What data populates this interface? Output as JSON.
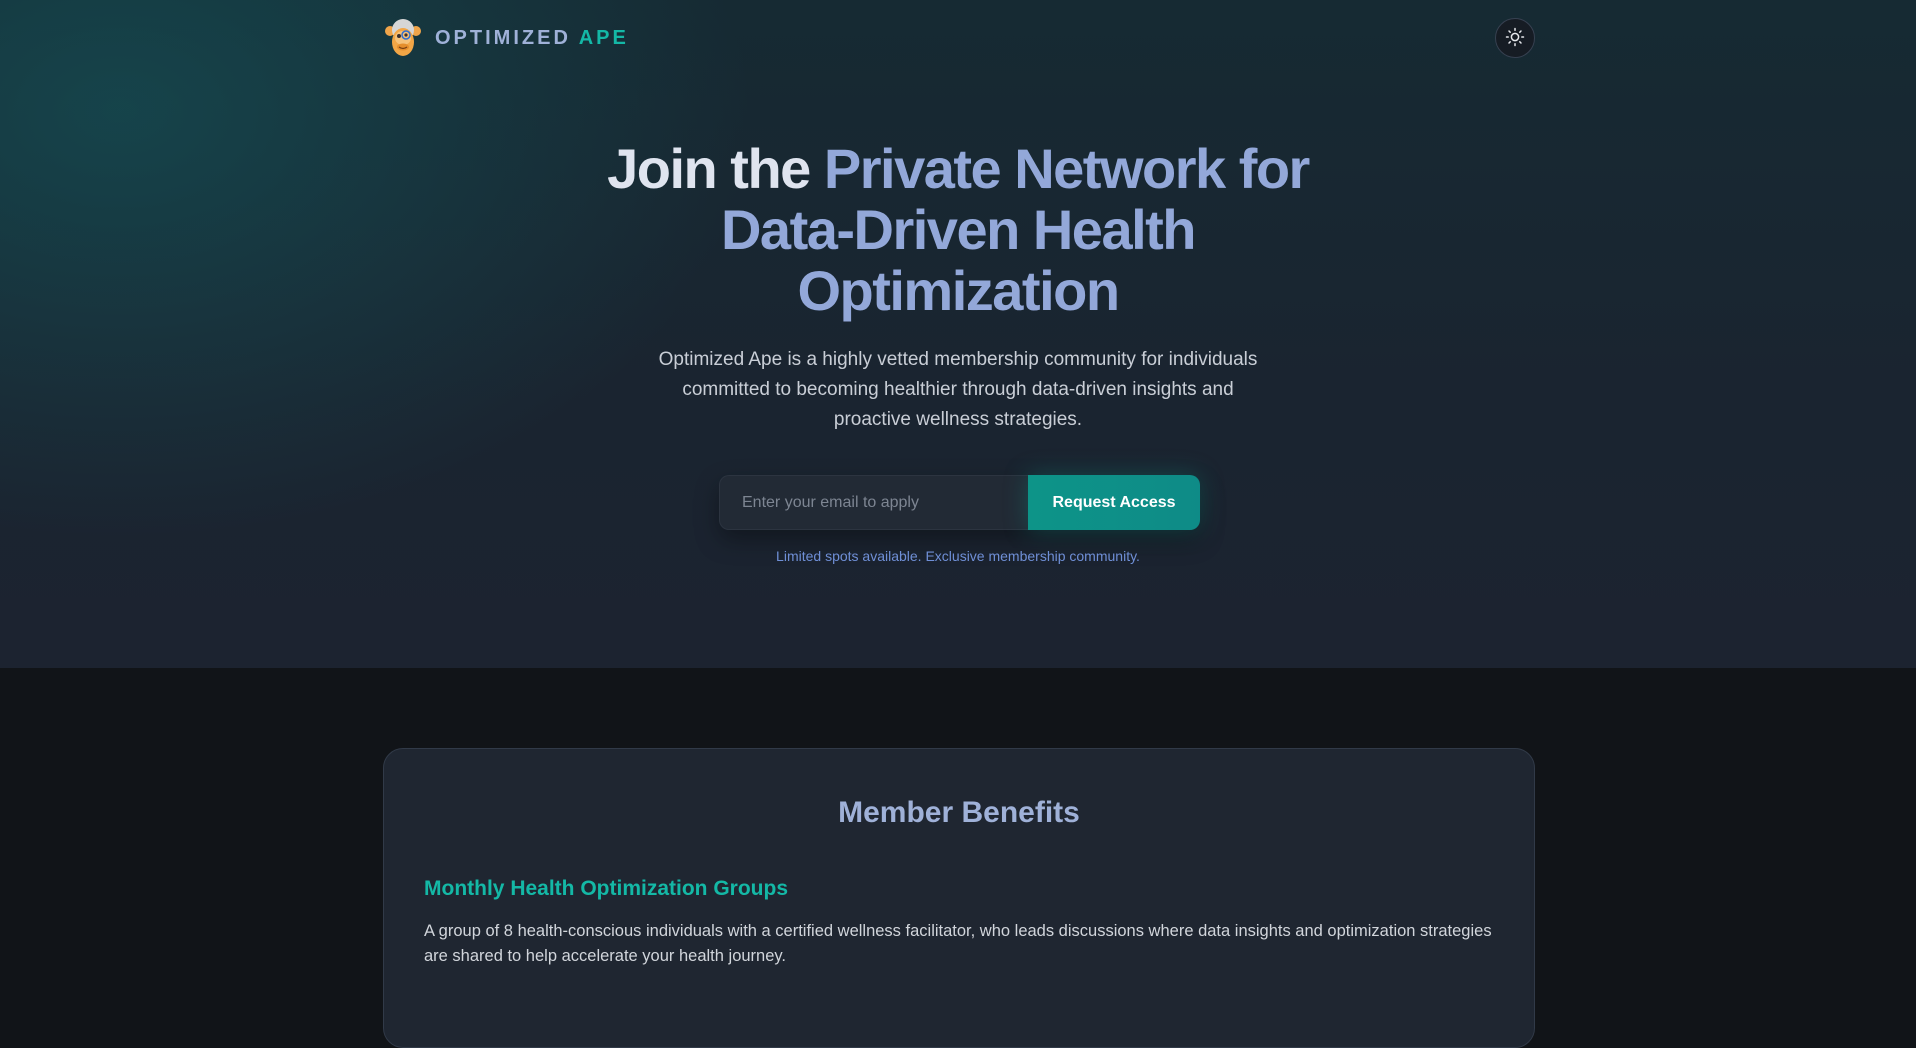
{
  "header": {
    "brand_main": "OPTIMIZED ",
    "brand_accent": "APE",
    "logo_icon": "ape-face-icon",
    "theme_toggle_icon": "sun-icon"
  },
  "hero": {
    "headline_part1": "Join the ",
    "headline_part2": "Private Network for Data-Driven Health Optimization",
    "subtitle": "Optimized Ape is a highly vetted membership community for individuals committed to becoming healthier through data-driven insights and proactive wellness strategies.",
    "email_placeholder": "Enter your email to apply",
    "email_value": "",
    "cta_label": "Request Access",
    "note": "Limited spots available. Exclusive membership community."
  },
  "benefits": {
    "title": "Member Benefits",
    "items": [
      {
        "title": "Monthly Health Optimization Groups",
        "description": "A group of 8 health-conscious individuals with a certified wellness facilitator, who leads discussions where data insights and optimization strategies are shared to help accelerate your health journey."
      }
    ]
  },
  "colors": {
    "accent": "#14b8a6",
    "headline_highlight": "#93a8d9",
    "button": "#0d9488",
    "background": "#111418"
  }
}
